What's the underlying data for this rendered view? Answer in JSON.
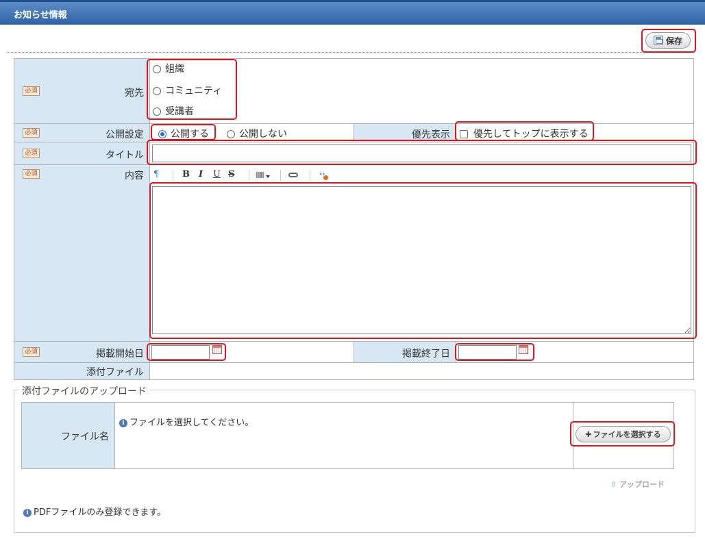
{
  "header": {
    "title": "お知らせ情報"
  },
  "toolbar": {
    "save_label": "保存"
  },
  "form": {
    "required_badge": "必須",
    "recipient": {
      "label": "宛先",
      "options": [
        "組織",
        "コミュニティ",
        "受講者"
      ]
    },
    "publish": {
      "label": "公開設定",
      "options": [
        "公開する",
        "公開しない"
      ],
      "selected": "公開する"
    },
    "priority": {
      "label": "優先表示",
      "checkbox_label": "優先してトップに表示する"
    },
    "title": {
      "label": "タイトル",
      "value": ""
    },
    "content": {
      "label": "内容",
      "value": "",
      "toolbar": {
        "paragraph": "¶",
        "bold": "B",
        "italic": "I",
        "underline": "U",
        "strike": "S"
      }
    },
    "start_date": {
      "label": "掲載開始日",
      "value": ""
    },
    "end_date": {
      "label": "掲載終了日",
      "value": ""
    },
    "attachment": {
      "label": "添付ファイル"
    }
  },
  "upload": {
    "legend": "添付ファイルのアップロード",
    "file_name_label": "ファイル名",
    "info_message": "ファイルを選択してください。",
    "select_button": "ファイルを選択する",
    "upload_link": "アップロード",
    "note": "PDFファイルのみ登録できます。"
  },
  "colors": {
    "header_bg": "#2f63a6",
    "label_bg": "#d7e7f3",
    "highlight": "#e0141e"
  }
}
